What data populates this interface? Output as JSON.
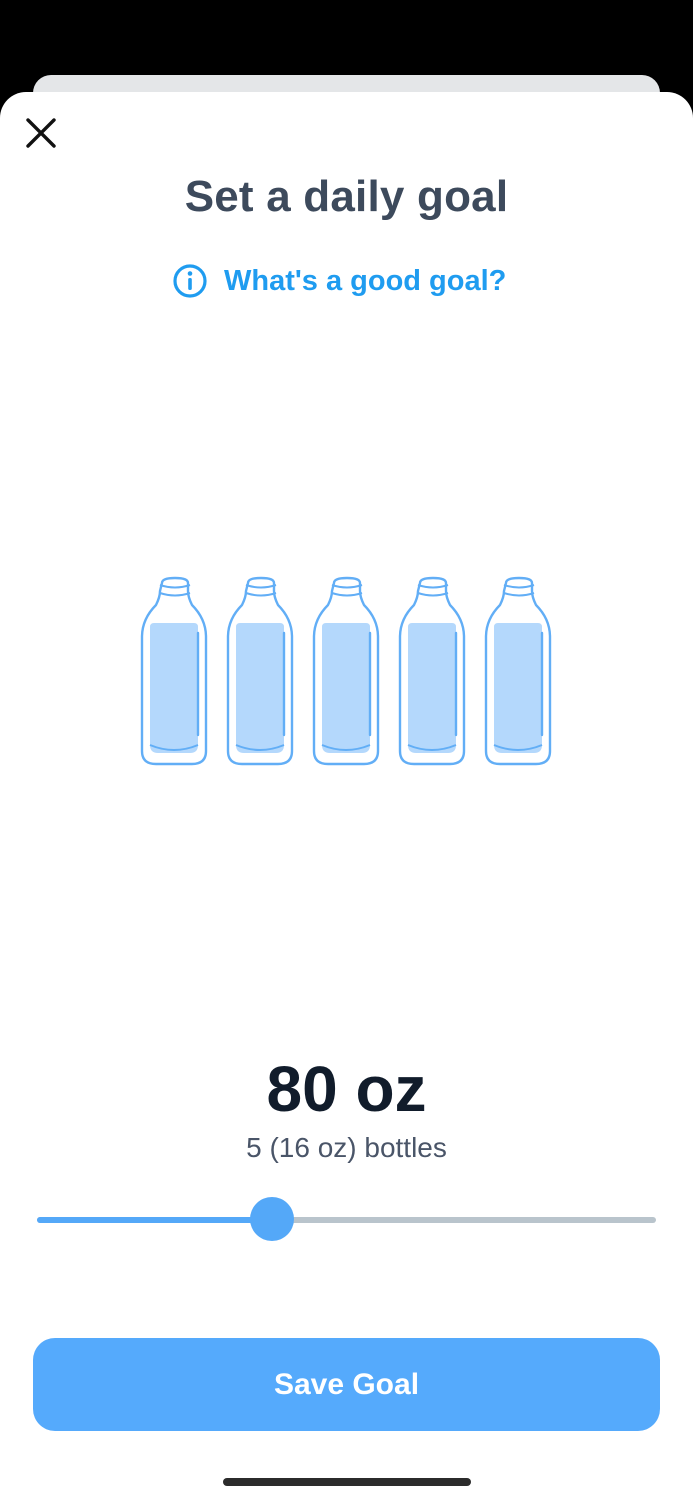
{
  "header": {
    "title": "Set a daily goal",
    "close_icon": "close-icon"
  },
  "help": {
    "icon": "info-icon",
    "label": "What's a good goal?"
  },
  "goal": {
    "amount": "80 oz",
    "bottles_text": "5 (16 oz) bottles",
    "bottle_count": 5
  },
  "slider": {
    "fraction": 0.38
  },
  "actions": {
    "save_label": "Save Goal"
  },
  "colors": {
    "accent": "#1f9cf0",
    "button": "#55aafc",
    "slider_fill": "#54a8f8",
    "slider_track": "#b9c4cc",
    "bottle_outline": "#62aef6",
    "bottle_water": "#b4d8fc",
    "title": "#3d4a5c"
  }
}
